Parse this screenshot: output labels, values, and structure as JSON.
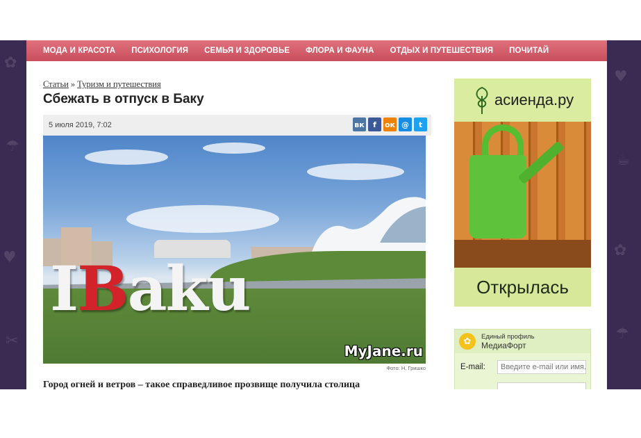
{
  "nav": {
    "items": [
      "МОДА И КРАСОТА",
      "ПСИХОЛОГИЯ",
      "СЕМЬЯ И ЗДОРОВЬЕ",
      "ФЛОРА И ФАУНА",
      "ОТДЫХ И ПУТЕШЕСТВИЯ",
      "ПОЧИТАЙ"
    ]
  },
  "breadcrumb": {
    "root": "Статьи",
    "separator": "»",
    "section": "Туризм и путешествия"
  },
  "article": {
    "title": "Сбежать в отпуск в Баку",
    "date": "5 июля 2019, 7:02",
    "photo_sign_i": "I",
    "photo_sign_b": "B",
    "photo_sign_rest": "aku",
    "watermark": "MyJane.ru",
    "photo_credit": "Фото: Н. Гришко",
    "lede": "Город огней и ветров – такое справедливое прозвище получила столица"
  },
  "share": {
    "vk": "вк",
    "facebook": "f",
    "odnoklassniki": "ок",
    "mailru": "@",
    "twitter": "t"
  },
  "ad": {
    "brand": "асиенда.ру",
    "headline": "Открылась"
  },
  "login": {
    "title": "Единый профиль",
    "brand": "МедиаФорт",
    "email_label": "E-mail:",
    "email_placeholder": "Введите e-mail или имя."
  }
}
